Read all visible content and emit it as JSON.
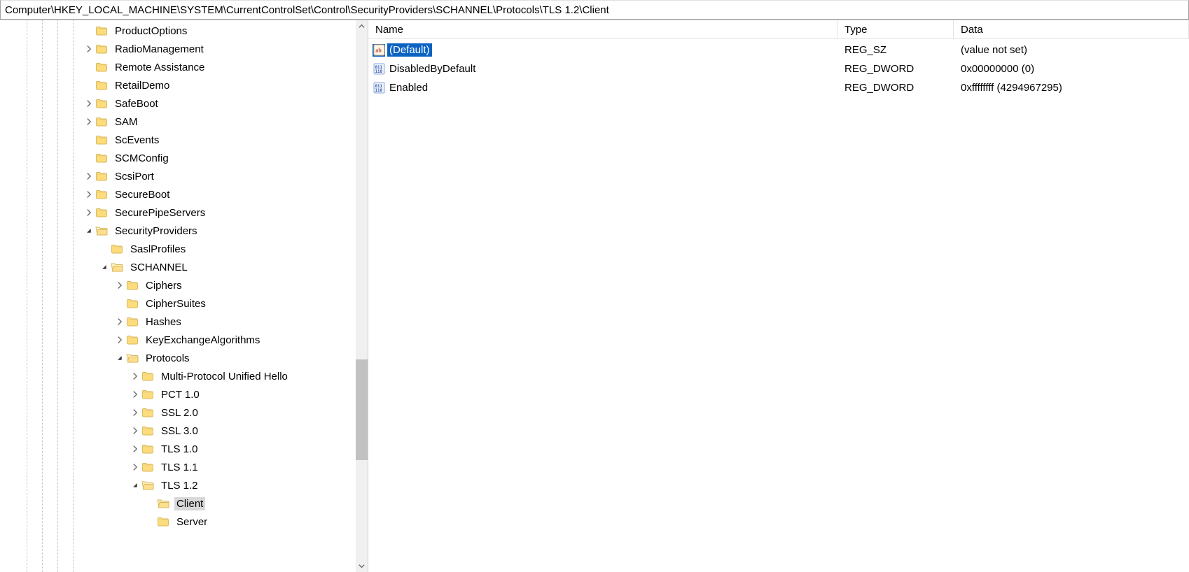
{
  "address": "Computer\\HKEY_LOCAL_MACHINE\\SYSTEM\\CurrentControlSet\\Control\\SecurityProviders\\SCHANNEL\\Protocols\\TLS 1.2\\Client",
  "headers": {
    "name": "Name",
    "type": "Type",
    "data": "Data"
  },
  "tree": [
    {
      "indent": 5,
      "expander": "",
      "label": "ProductOptions"
    },
    {
      "indent": 5,
      "expander": "closed",
      "label": "RadioManagement"
    },
    {
      "indent": 5,
      "expander": "",
      "label": "Remote Assistance"
    },
    {
      "indent": 5,
      "expander": "",
      "label": "RetailDemo"
    },
    {
      "indent": 5,
      "expander": "closed",
      "label": "SafeBoot"
    },
    {
      "indent": 5,
      "expander": "closed",
      "label": "SAM"
    },
    {
      "indent": 5,
      "expander": "",
      "label": "ScEvents"
    },
    {
      "indent": 5,
      "expander": "",
      "label": "SCMConfig"
    },
    {
      "indent": 5,
      "expander": "closed",
      "label": "ScsiPort"
    },
    {
      "indent": 5,
      "expander": "closed",
      "label": "SecureBoot"
    },
    {
      "indent": 5,
      "expander": "closed",
      "label": "SecurePipeServers"
    },
    {
      "indent": 5,
      "expander": "open",
      "label": "SecurityProviders"
    },
    {
      "indent": 6,
      "expander": "",
      "label": "SaslProfiles"
    },
    {
      "indent": 6,
      "expander": "open",
      "label": "SCHANNEL"
    },
    {
      "indent": 7,
      "expander": "closed",
      "label": "Ciphers"
    },
    {
      "indent": 7,
      "expander": "",
      "label": "CipherSuites"
    },
    {
      "indent": 7,
      "expander": "closed",
      "label": "Hashes"
    },
    {
      "indent": 7,
      "expander": "closed",
      "label": "KeyExchangeAlgorithms"
    },
    {
      "indent": 7,
      "expander": "open",
      "label": "Protocols"
    },
    {
      "indent": 8,
      "expander": "closed",
      "label": "Multi-Protocol Unified Hello"
    },
    {
      "indent": 8,
      "expander": "closed",
      "label": "PCT 1.0"
    },
    {
      "indent": 8,
      "expander": "closed",
      "label": "SSL 2.0"
    },
    {
      "indent": 8,
      "expander": "closed",
      "label": "SSL 3.0"
    },
    {
      "indent": 8,
      "expander": "closed",
      "label": "TLS 1.0"
    },
    {
      "indent": 8,
      "expander": "closed",
      "label": "TLS 1.1"
    },
    {
      "indent": 8,
      "expander": "open",
      "label": "TLS 1.2"
    },
    {
      "indent": 9,
      "expander": "",
      "label": "Client",
      "selected": true
    },
    {
      "indent": 9,
      "expander": "",
      "label": "Server"
    }
  ],
  "values": [
    {
      "icon": "string",
      "name": "(Default)",
      "type": "REG_SZ",
      "data": "(value not set)",
      "selected": true
    },
    {
      "icon": "binary",
      "name": "DisabledByDefault",
      "type": "REG_DWORD",
      "data": "0x00000000 (0)"
    },
    {
      "icon": "binary",
      "name": "Enabled",
      "type": "REG_DWORD",
      "data": "0xffffffff (4294967295)"
    }
  ],
  "scrollbar": {
    "thumbTopPct": 62,
    "thumbHeightPct": 19
  }
}
